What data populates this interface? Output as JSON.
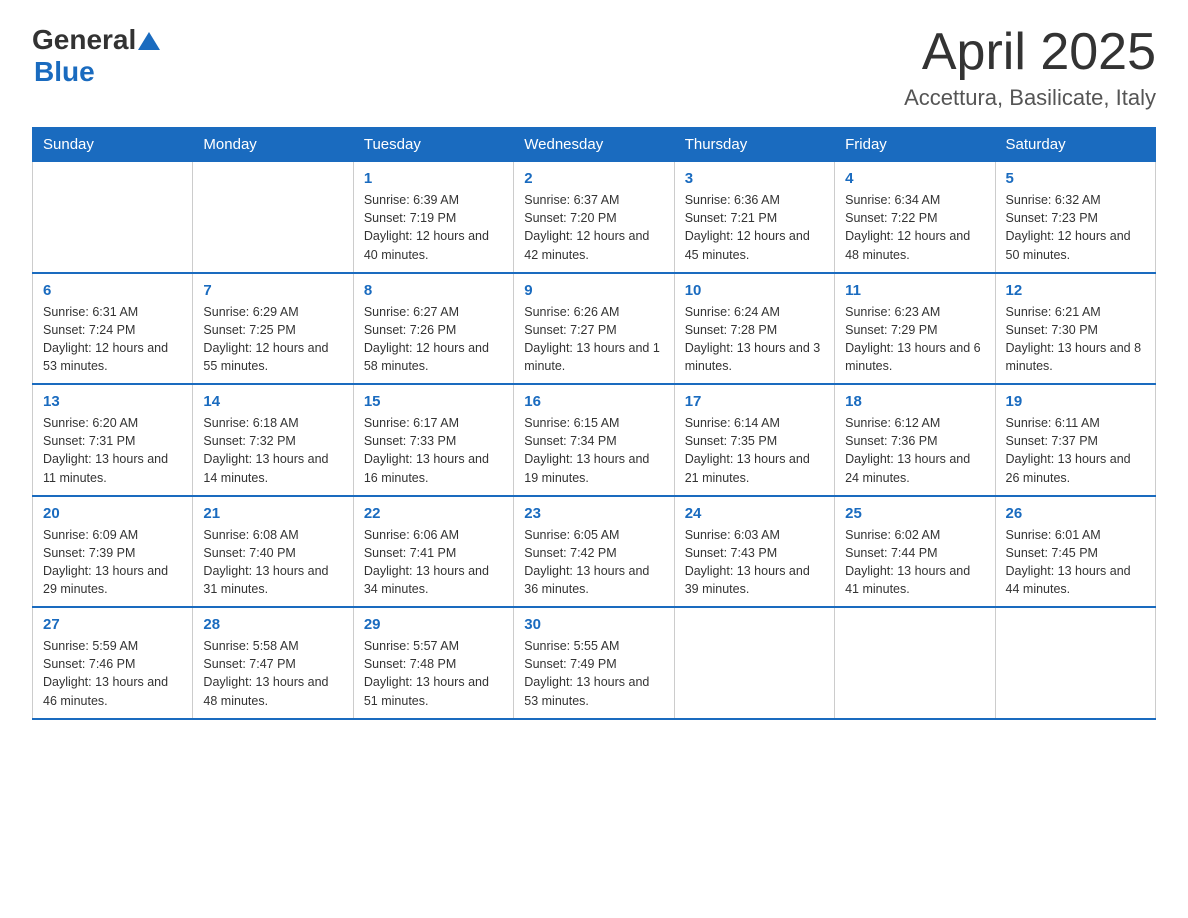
{
  "logo": {
    "general": "General",
    "blue": "Blue"
  },
  "header": {
    "title": "April 2025",
    "subtitle": "Accettura, Basilicate, Italy"
  },
  "days_of_week": [
    "Sunday",
    "Monday",
    "Tuesday",
    "Wednesday",
    "Thursday",
    "Friday",
    "Saturday"
  ],
  "weeks": [
    [
      {
        "day": "",
        "info": ""
      },
      {
        "day": "",
        "info": ""
      },
      {
        "day": "1",
        "info": "Sunrise: 6:39 AM\nSunset: 7:19 PM\nDaylight: 12 hours and 40 minutes."
      },
      {
        "day": "2",
        "info": "Sunrise: 6:37 AM\nSunset: 7:20 PM\nDaylight: 12 hours and 42 minutes."
      },
      {
        "day": "3",
        "info": "Sunrise: 6:36 AM\nSunset: 7:21 PM\nDaylight: 12 hours and 45 minutes."
      },
      {
        "day": "4",
        "info": "Sunrise: 6:34 AM\nSunset: 7:22 PM\nDaylight: 12 hours and 48 minutes."
      },
      {
        "day": "5",
        "info": "Sunrise: 6:32 AM\nSunset: 7:23 PM\nDaylight: 12 hours and 50 minutes."
      }
    ],
    [
      {
        "day": "6",
        "info": "Sunrise: 6:31 AM\nSunset: 7:24 PM\nDaylight: 12 hours and 53 minutes."
      },
      {
        "day": "7",
        "info": "Sunrise: 6:29 AM\nSunset: 7:25 PM\nDaylight: 12 hours and 55 minutes."
      },
      {
        "day": "8",
        "info": "Sunrise: 6:27 AM\nSunset: 7:26 PM\nDaylight: 12 hours and 58 minutes."
      },
      {
        "day": "9",
        "info": "Sunrise: 6:26 AM\nSunset: 7:27 PM\nDaylight: 13 hours and 1 minute."
      },
      {
        "day": "10",
        "info": "Sunrise: 6:24 AM\nSunset: 7:28 PM\nDaylight: 13 hours and 3 minutes."
      },
      {
        "day": "11",
        "info": "Sunrise: 6:23 AM\nSunset: 7:29 PM\nDaylight: 13 hours and 6 minutes."
      },
      {
        "day": "12",
        "info": "Sunrise: 6:21 AM\nSunset: 7:30 PM\nDaylight: 13 hours and 8 minutes."
      }
    ],
    [
      {
        "day": "13",
        "info": "Sunrise: 6:20 AM\nSunset: 7:31 PM\nDaylight: 13 hours and 11 minutes."
      },
      {
        "day": "14",
        "info": "Sunrise: 6:18 AM\nSunset: 7:32 PM\nDaylight: 13 hours and 14 minutes."
      },
      {
        "day": "15",
        "info": "Sunrise: 6:17 AM\nSunset: 7:33 PM\nDaylight: 13 hours and 16 minutes."
      },
      {
        "day": "16",
        "info": "Sunrise: 6:15 AM\nSunset: 7:34 PM\nDaylight: 13 hours and 19 minutes."
      },
      {
        "day": "17",
        "info": "Sunrise: 6:14 AM\nSunset: 7:35 PM\nDaylight: 13 hours and 21 minutes."
      },
      {
        "day": "18",
        "info": "Sunrise: 6:12 AM\nSunset: 7:36 PM\nDaylight: 13 hours and 24 minutes."
      },
      {
        "day": "19",
        "info": "Sunrise: 6:11 AM\nSunset: 7:37 PM\nDaylight: 13 hours and 26 minutes."
      }
    ],
    [
      {
        "day": "20",
        "info": "Sunrise: 6:09 AM\nSunset: 7:39 PM\nDaylight: 13 hours and 29 minutes."
      },
      {
        "day": "21",
        "info": "Sunrise: 6:08 AM\nSunset: 7:40 PM\nDaylight: 13 hours and 31 minutes."
      },
      {
        "day": "22",
        "info": "Sunrise: 6:06 AM\nSunset: 7:41 PM\nDaylight: 13 hours and 34 minutes."
      },
      {
        "day": "23",
        "info": "Sunrise: 6:05 AM\nSunset: 7:42 PM\nDaylight: 13 hours and 36 minutes."
      },
      {
        "day": "24",
        "info": "Sunrise: 6:03 AM\nSunset: 7:43 PM\nDaylight: 13 hours and 39 minutes."
      },
      {
        "day": "25",
        "info": "Sunrise: 6:02 AM\nSunset: 7:44 PM\nDaylight: 13 hours and 41 minutes."
      },
      {
        "day": "26",
        "info": "Sunrise: 6:01 AM\nSunset: 7:45 PM\nDaylight: 13 hours and 44 minutes."
      }
    ],
    [
      {
        "day": "27",
        "info": "Sunrise: 5:59 AM\nSunset: 7:46 PM\nDaylight: 13 hours and 46 minutes."
      },
      {
        "day": "28",
        "info": "Sunrise: 5:58 AM\nSunset: 7:47 PM\nDaylight: 13 hours and 48 minutes."
      },
      {
        "day": "29",
        "info": "Sunrise: 5:57 AM\nSunset: 7:48 PM\nDaylight: 13 hours and 51 minutes."
      },
      {
        "day": "30",
        "info": "Sunrise: 5:55 AM\nSunset: 7:49 PM\nDaylight: 13 hours and 53 minutes."
      },
      {
        "day": "",
        "info": ""
      },
      {
        "day": "",
        "info": ""
      },
      {
        "day": "",
        "info": ""
      }
    ]
  ]
}
